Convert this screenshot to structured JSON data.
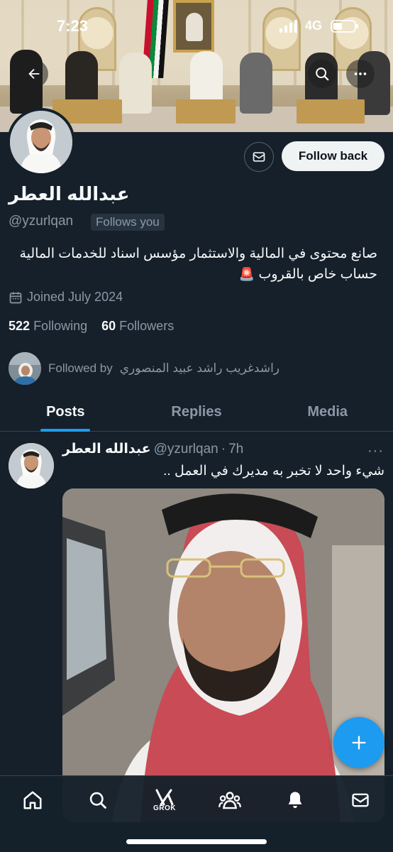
{
  "status_bar": {
    "time": "7:23",
    "network": "4G"
  },
  "header": {
    "back_icon": "arrow-left-icon",
    "search_icon": "search-icon",
    "more_icon": "more-horizontal-icon"
  },
  "profile": {
    "display_name": "عبدالله العطر",
    "handle": "@yzurlqan",
    "follows_you": "Follows you",
    "follow_button": "Follow back",
    "bio": "صانع محتوى في المالية والاستثمار مؤسس اسناد للخدمات المالية حساب خاص بالقروب",
    "bio_emoji": "🚨",
    "joined": "Joined July 2024",
    "following_count": "522",
    "following_label": "Following",
    "followers_count": "60",
    "followers_label": "Followers",
    "followed_by_prefix": "Followed by",
    "followed_by_names": "راشدغريب راشد عبيد المنصوري"
  },
  "tabs": [
    {
      "label": "Posts",
      "active": true
    },
    {
      "label": "Replies",
      "active": false
    },
    {
      "label": "Media",
      "active": false
    }
  ],
  "post": {
    "author": "عبدالله العطر",
    "handle": "@yzurlqan",
    "separator": "·",
    "time": "7h",
    "text": "شيء واحد لا تخبر به مديرك في العمل .."
  },
  "bottom_nav": {
    "items": [
      "home-icon",
      "search-icon",
      "grok-icon",
      "communities-icon",
      "notifications-icon",
      "messages-icon"
    ],
    "grok_label": "GROK"
  },
  "colors": {
    "background": "#15202b",
    "accent": "#1d9bf0",
    "secondary_text": "#8b98a5"
  }
}
